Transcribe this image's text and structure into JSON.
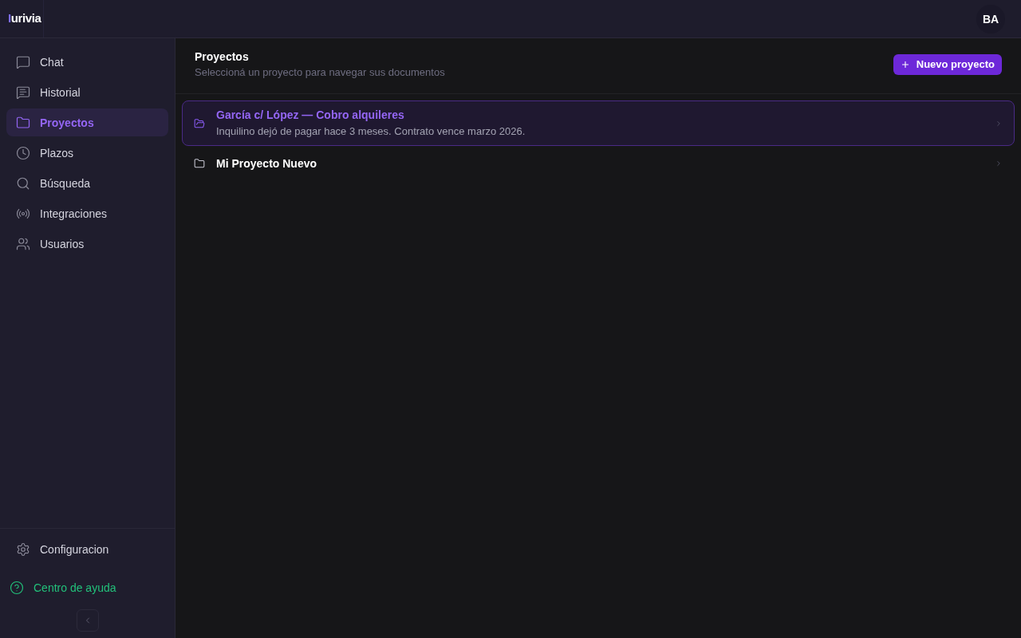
{
  "header": {
    "logo": {
      "accent": "I",
      "rest": "urivia"
    },
    "avatar": "BA"
  },
  "sidebar": {
    "items": [
      {
        "label": "Chat",
        "selected": false
      },
      {
        "label": "Historial",
        "selected": false
      },
      {
        "label": "Proyectos",
        "selected": true
      },
      {
        "label": "Plazos",
        "selected": false
      },
      {
        "label": "Búsqueda",
        "selected": false
      },
      {
        "label": "Integraciones",
        "selected": false
      },
      {
        "label": "Usuarios",
        "selected": false
      }
    ],
    "settings": "Configuracion",
    "help": "Centro de ayuda"
  },
  "main": {
    "title": "Proyectos",
    "subtitle": "Seleccioná un proyecto para navegar sus documentos",
    "new_button": "Nuevo proyecto",
    "projects": [
      {
        "name": "García c/ López — Cobro alquileres",
        "description": "Inquilino dejó de pagar hace 3 meses. Contrato vence marzo 2026.",
        "selected": true
      },
      {
        "name": "Mi Proyecto Nuevo",
        "selected": false
      }
    ]
  }
}
